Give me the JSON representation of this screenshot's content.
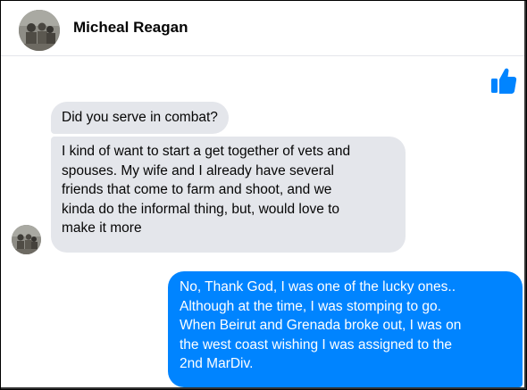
{
  "contact": {
    "name": "Micheal Reagan",
    "avatar_icon": "contact-avatar-photo"
  },
  "like_icon": "thumbs-up-icon",
  "colors": {
    "accent": "#0084ff",
    "received_bubble": "#e4e6eb",
    "text": "#050505"
  },
  "messages": [
    {
      "sender": "contact",
      "text": "Did you serve in combat?"
    },
    {
      "sender": "contact",
      "text": "I kind of want to start a get together of vets and\nspouses. My wife and I already have several\nfriends that come to farm and shoot, and we\nkinda do the informal thing, but, would love to\nmake it more"
    },
    {
      "sender": "me",
      "text": "No, Thank God, I was one of the lucky ones..\nAlthough at the time, I was stomping to go.\nWhen Beirut and Grenada broke out, I was on\nthe west coast wishing I was assigned to the\n2nd MarDiv."
    }
  ]
}
